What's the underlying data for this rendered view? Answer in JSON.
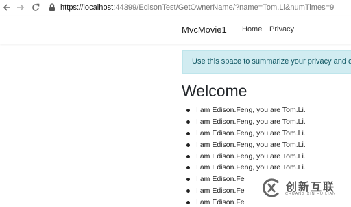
{
  "browser": {
    "url_origin": "https://localhost",
    "url_rest": ":44399/EdisonTest/GetOwnerName/?name=Tom.Li&numTimes=9"
  },
  "header": {
    "brand": "MvcMovie1",
    "nav": [
      "Home",
      "Privacy"
    ]
  },
  "cookie": {
    "text": "Use this space to summarize your privacy and co"
  },
  "main": {
    "title": "Welcome",
    "items": [
      "I am Edison.Feng, you are Tom.Li.",
      "I am Edison.Feng, you are Tom.Li.",
      "I am Edison.Feng, you are Tom.Li.",
      "I am Edison.Feng, you are Tom.Li.",
      "I am Edison.Feng, you are Tom.Li.",
      "I am Edison.Feng, you are Tom.Li.",
      "I am Edison.Fe",
      "I am Edison.Fe",
      "I am Edison.Fe"
    ]
  },
  "watermark": {
    "title": "创新互联",
    "subtitle": "CHUANG XIN HU LIAN"
  }
}
